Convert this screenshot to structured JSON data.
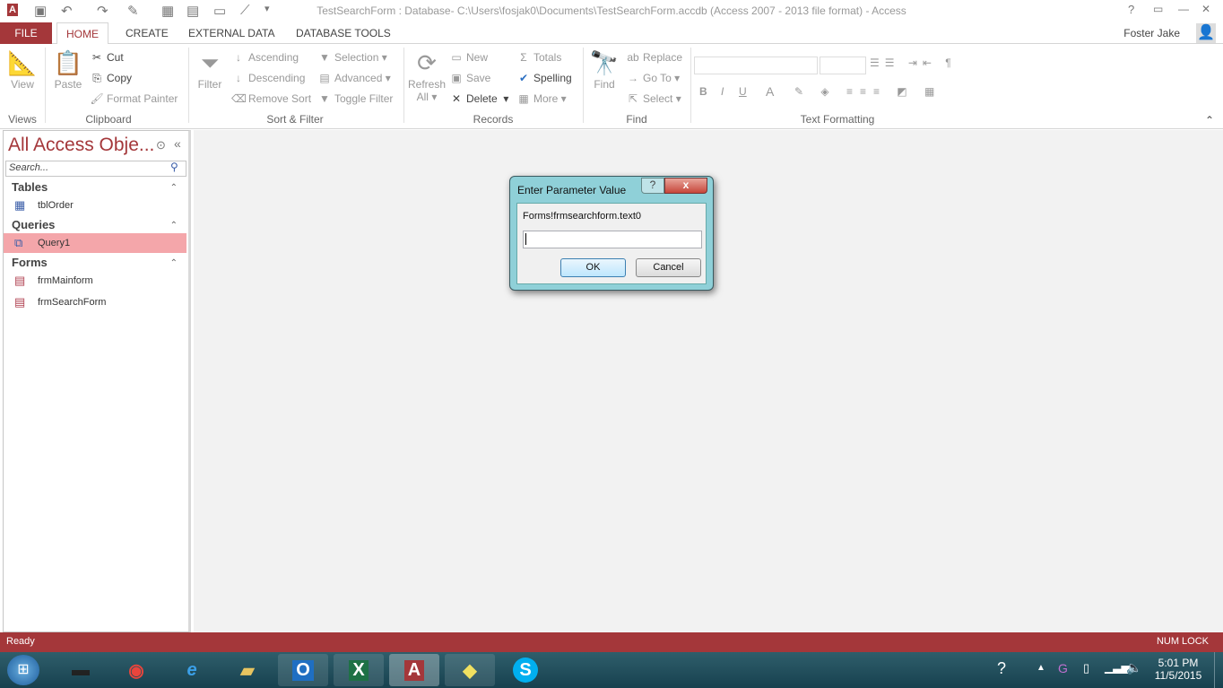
{
  "window": {
    "title": "TestSearchForm : Database- C:\\Users\\fosjak0\\Documents\\TestSearchForm.accdb (Access 2007 - 2013 file format) - Access",
    "user": "Foster Jake"
  },
  "tabs": [
    "FILE",
    "HOME",
    "CREATE",
    "EXTERNAL DATA",
    "DATABASE TOOLS"
  ],
  "ribbon": {
    "views": {
      "view": "View",
      "group": "Views"
    },
    "clipboard": {
      "paste": "Paste",
      "cut": "Cut",
      "copy": "Copy",
      "format_painter": "Format Painter",
      "group": "Clipboard"
    },
    "sort_filter": {
      "filter": "Filter",
      "ascending": "Ascending",
      "descending": "Descending",
      "remove_sort": "Remove Sort",
      "selection": "Selection",
      "advanced": "Advanced",
      "toggle_filter": "Toggle Filter",
      "group": "Sort & Filter"
    },
    "records": {
      "refresh": "Refresh",
      "refresh2": "All",
      "new": "New",
      "save": "Save",
      "delete": "Delete",
      "totals": "Totals",
      "spelling": "Spelling",
      "more": "More",
      "group": "Records"
    },
    "find": {
      "find": "Find",
      "replace": "Replace",
      "goto": "Go To",
      "select": "Select",
      "group": "Find"
    },
    "text_formatting": {
      "bold": "B",
      "italic": "I",
      "underline": "U",
      "font_color": "A",
      "group": "Text Formatting"
    }
  },
  "nav": {
    "title": "All Access Obje...",
    "search_placeholder": "Search...",
    "groups": [
      {
        "label": "Tables",
        "items": [
          "tblOrder"
        ]
      },
      {
        "label": "Queries",
        "items": [
          "Query1"
        ]
      },
      {
        "label": "Forms",
        "items": [
          "frmMainform",
          "frmSearchForm"
        ]
      }
    ],
    "selected": "Query1"
  },
  "dialog": {
    "title": "Enter Parameter Value",
    "prompt": "Forms!frmsearchform.text0",
    "value": "",
    "ok": "OK",
    "cancel": "Cancel",
    "help": "?",
    "close": "x"
  },
  "status": {
    "left": "Ready",
    "right": "NUM LOCK"
  },
  "taskbar": {
    "time": "5:01 PM",
    "date": "11/5/2015",
    "apps": [
      "media",
      "chrome",
      "internet-explorer",
      "file-explorer",
      "outlook",
      "excel",
      "access",
      "sticky-notes",
      "skype"
    ]
  },
  "colors": {
    "accent": "#a4373a",
    "selected": "#f4a6aa",
    "dialog_frame": "#8fd0d8"
  }
}
